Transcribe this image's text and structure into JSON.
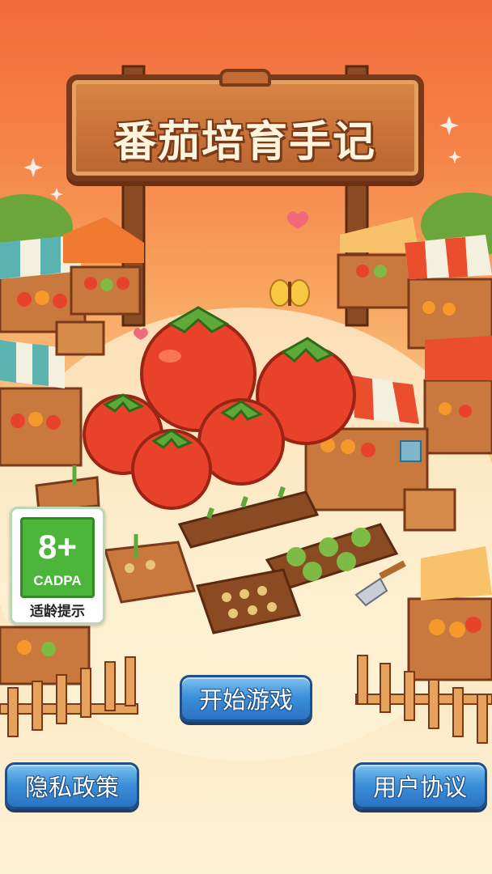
{
  "game": {
    "title": "番茄培育手记"
  },
  "age_rating": {
    "rating": "8+",
    "org": "CADPA",
    "note": "适龄提示"
  },
  "buttons": {
    "start": "开始游戏",
    "privacy": "隐私政策",
    "user_agreement": "用户协议"
  },
  "colors": {
    "sky_top": "#f26a3a",
    "ground": "#fdf1d6",
    "button_blue": "#3b8fd8",
    "tomato_red": "#e8432a",
    "badge_green": "#4bb63a"
  }
}
